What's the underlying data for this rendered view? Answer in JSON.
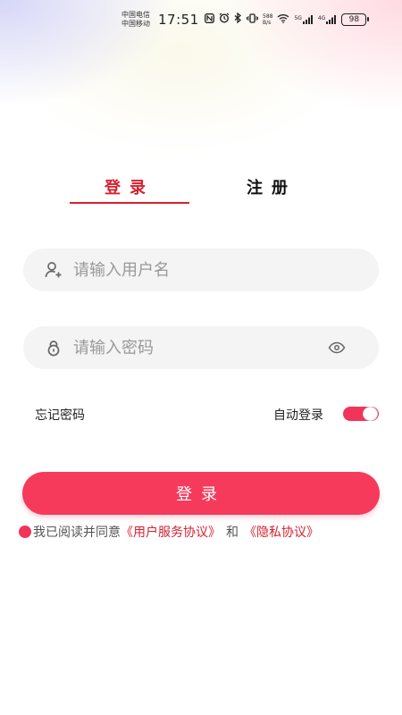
{
  "status_bar": {
    "carrier_1": "中国电信",
    "carrier_2": "中国移动",
    "time": "17:51",
    "net_speed_value": "588",
    "net_speed_unit": "B/s",
    "signal_1_label": "5G",
    "signal_2_label": "4G",
    "battery": "98"
  },
  "tabs": {
    "login": "登录",
    "register": "注册",
    "active": "login"
  },
  "form": {
    "username_placeholder": "请输入用户名",
    "password_placeholder": "请输入密码",
    "username_icon": "user-add-icon",
    "password_icon": "lock-icon",
    "visibility_icon": "eye-icon"
  },
  "options": {
    "forgot_password": "忘记密码",
    "auto_login": "自动登录",
    "auto_login_enabled": true
  },
  "login_button": "登录",
  "agreement": {
    "prefix": "我已阅读并同意",
    "service_link": "《用户服务协议》",
    "and": "和",
    "privacy_link": "《隐私协议》"
  },
  "colors": {
    "accent": "#d6212f",
    "button": "#f53a5c",
    "field_bg": "#f4f4f4"
  }
}
